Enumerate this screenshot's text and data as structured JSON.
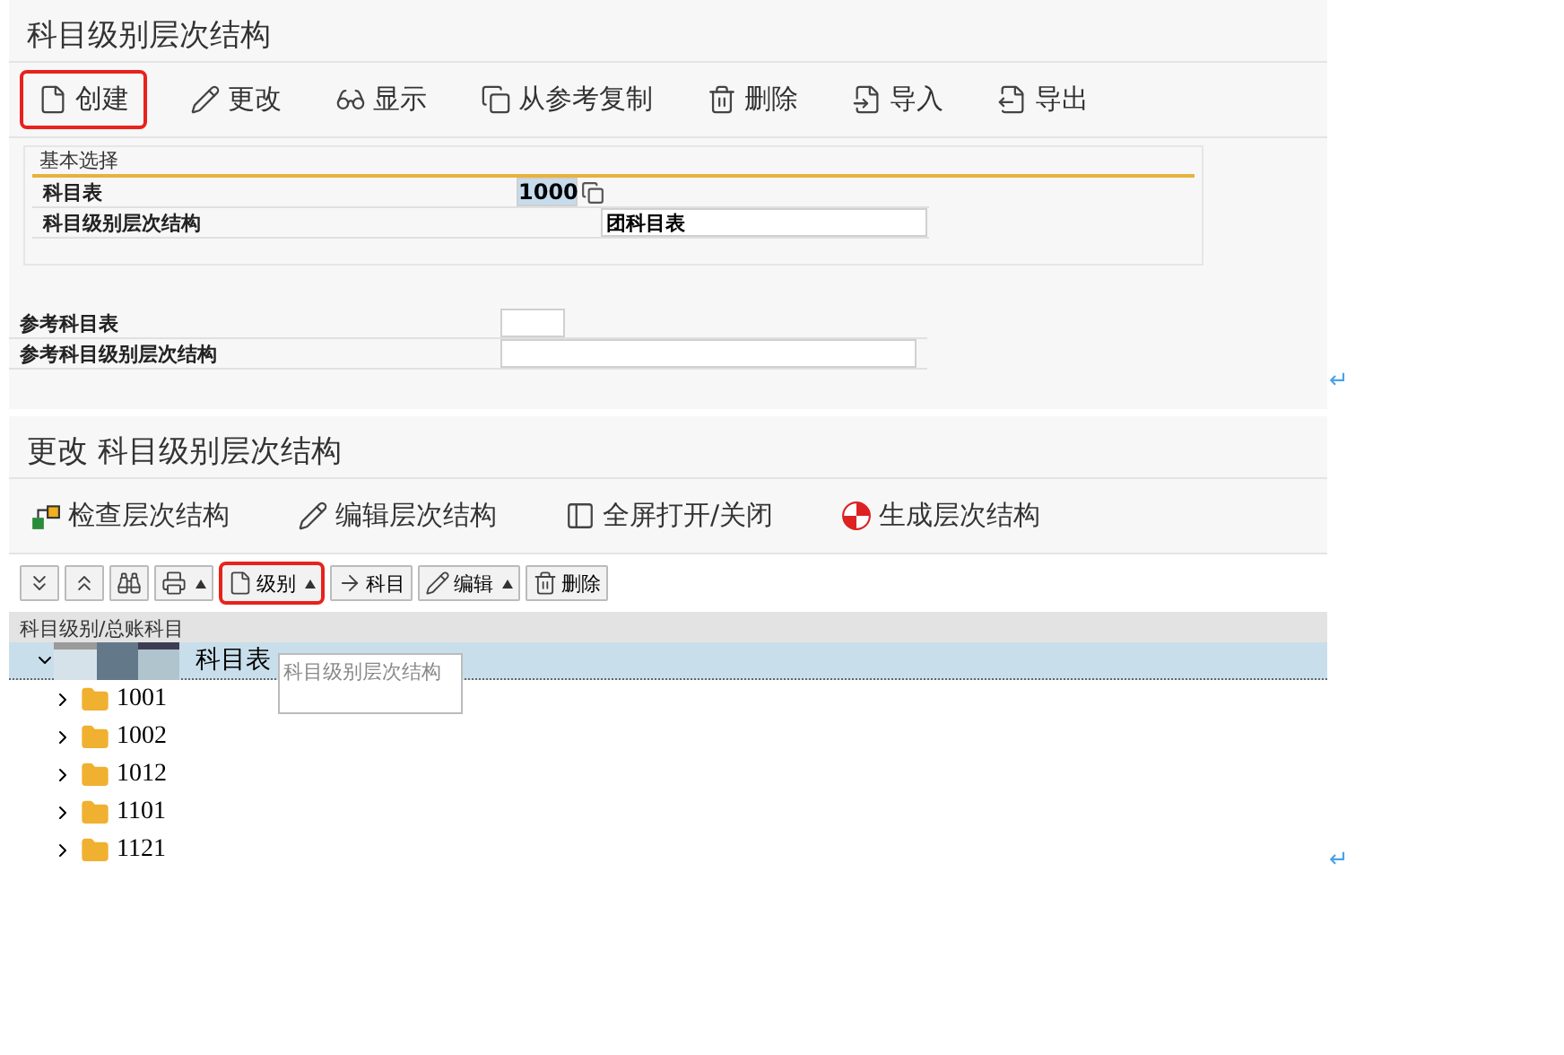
{
  "screen_1": {
    "title": "科目级别层次结构",
    "toolbar": [
      {
        "kind": "create",
        "label": "创建",
        "highlighted": true
      },
      {
        "kind": "edit",
        "label": "更改",
        "highlighted": false
      },
      {
        "kind": "display",
        "label": "显示",
        "highlighted": false
      },
      {
        "kind": "copy",
        "label": "从参考复制",
        "highlighted": false
      },
      {
        "kind": "delete",
        "label": "删除",
        "highlighted": false
      },
      {
        "kind": "import",
        "label": "导入",
        "highlighted": false
      },
      {
        "kind": "export",
        "label": "导出",
        "highlighted": false
      }
    ],
    "group": {
      "title": "基本选择",
      "fields": [
        {
          "label": "科目表",
          "value": "1000",
          "selected": true
        },
        {
          "label": "科目级别层次结构",
          "description": "团科目表"
        }
      ]
    },
    "reference_fields": [
      {
        "label": "参考科目表"
      },
      {
        "label": "参考科目级别层次结构"
      }
    ]
  },
  "screen_2": {
    "title": "更改  科目级别层次结构",
    "toolbar": [
      {
        "kind": "check",
        "label": "检查层次结构"
      },
      {
        "kind": "edit",
        "label": "编辑层次结构"
      },
      {
        "kind": "fullscreen",
        "label": "全屏打开/关闭"
      },
      {
        "kind": "generate",
        "label": "生成层次结构"
      }
    ],
    "small_toolbar": [
      {
        "kind": "expand",
        "dropdown": false,
        "highlighted": false
      },
      {
        "kind": "collapse",
        "dropdown": false,
        "highlighted": false
      },
      {
        "kind": "find",
        "dropdown": false,
        "highlighted": false
      },
      {
        "kind": "print",
        "dropdown": true,
        "highlighted": false
      },
      {
        "kind": "level",
        "label": "级别",
        "dropdown": true,
        "highlighted": true
      },
      {
        "kind": "account",
        "label": "科目",
        "dropdown": false,
        "highlighted": false
      },
      {
        "kind": "edit",
        "label": "编辑",
        "dropdown": true,
        "highlighted": false
      },
      {
        "kind": "delete",
        "label": "删除",
        "dropdown": false,
        "highlighted": false
      }
    ],
    "tree": {
      "header": "科目级别/总账科目",
      "root": {
        "label": "科目表",
        "expanded": true,
        "selected": true,
        "children": [
          {
            "label": "1001",
            "expanded": false
          },
          {
            "label": "1002",
            "expanded": false
          },
          {
            "label": "1012",
            "expanded": false
          },
          {
            "label": "1101",
            "expanded": false
          },
          {
            "label": "1121",
            "expanded": false
          }
        ]
      }
    },
    "tooltip": "科目级别层次结构"
  },
  "paragraph_marks": [
    "↵",
    "↵"
  ]
}
